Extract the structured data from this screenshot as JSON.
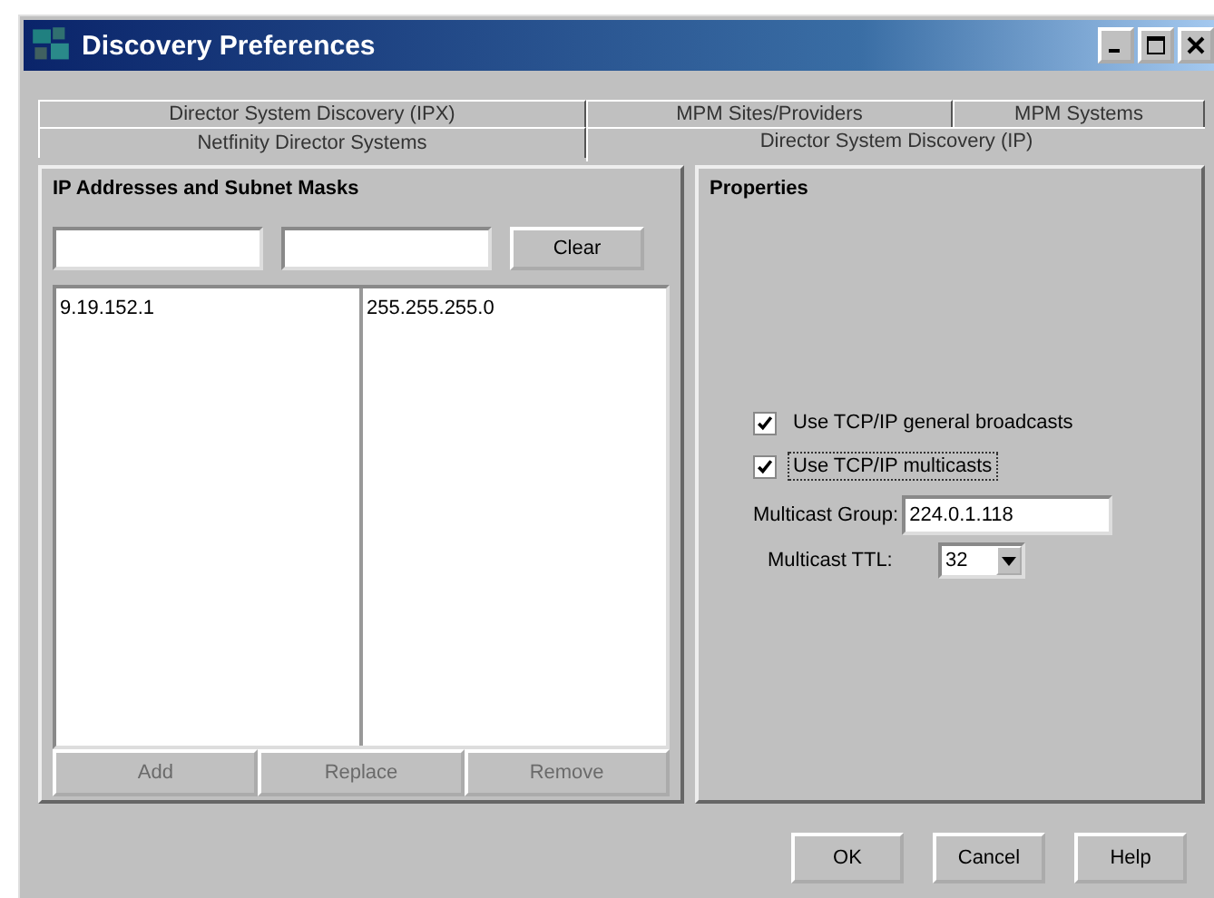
{
  "window": {
    "title": "Discovery Preferences"
  },
  "tab_rows": [
    {
      "tabs": [
        {
          "label": "Director System Discovery (IPX)",
          "selected": false
        },
        {
          "label": "MPM Sites/Providers",
          "selected": false
        },
        {
          "label": "MPM Systems",
          "selected": false
        }
      ]
    },
    {
      "tabs": [
        {
          "label": "Netfinity Director Systems",
          "selected": false
        },
        {
          "label": "Director System Discovery (IP)",
          "selected": true
        }
      ]
    }
  ],
  "addresses": {
    "title": "IP Addresses and Subnet Masks",
    "clear_button": {
      "label": "Clear"
    },
    "rows": [
      {
        "address": "9.19.152.1",
        "mask": "255.255.255.0"
      }
    ],
    "buttons": [
      {
        "label": "Add",
        "disabled": true
      },
      {
        "label": "Replace",
        "disabled": true
      },
      {
        "label": "Remove",
        "disabled": true
      }
    ]
  },
  "properties": {
    "title": "Properties",
    "checkboxes": [
      {
        "label": "Use TCP/IP general broadcasts",
        "checked": true,
        "focused": false
      },
      {
        "label": "Use TCP/IP multicasts",
        "checked": true,
        "focused": true
      }
    ],
    "multicast_group": {
      "label": "Multicast Group:",
      "value": "224.0.1.118"
    },
    "multicast_ttl": {
      "label": "Multicast TTL:",
      "value": "32"
    }
  },
  "buttons": [
    {
      "label": "OK"
    },
    {
      "label": "Cancel"
    },
    {
      "label": "Help"
    }
  ]
}
